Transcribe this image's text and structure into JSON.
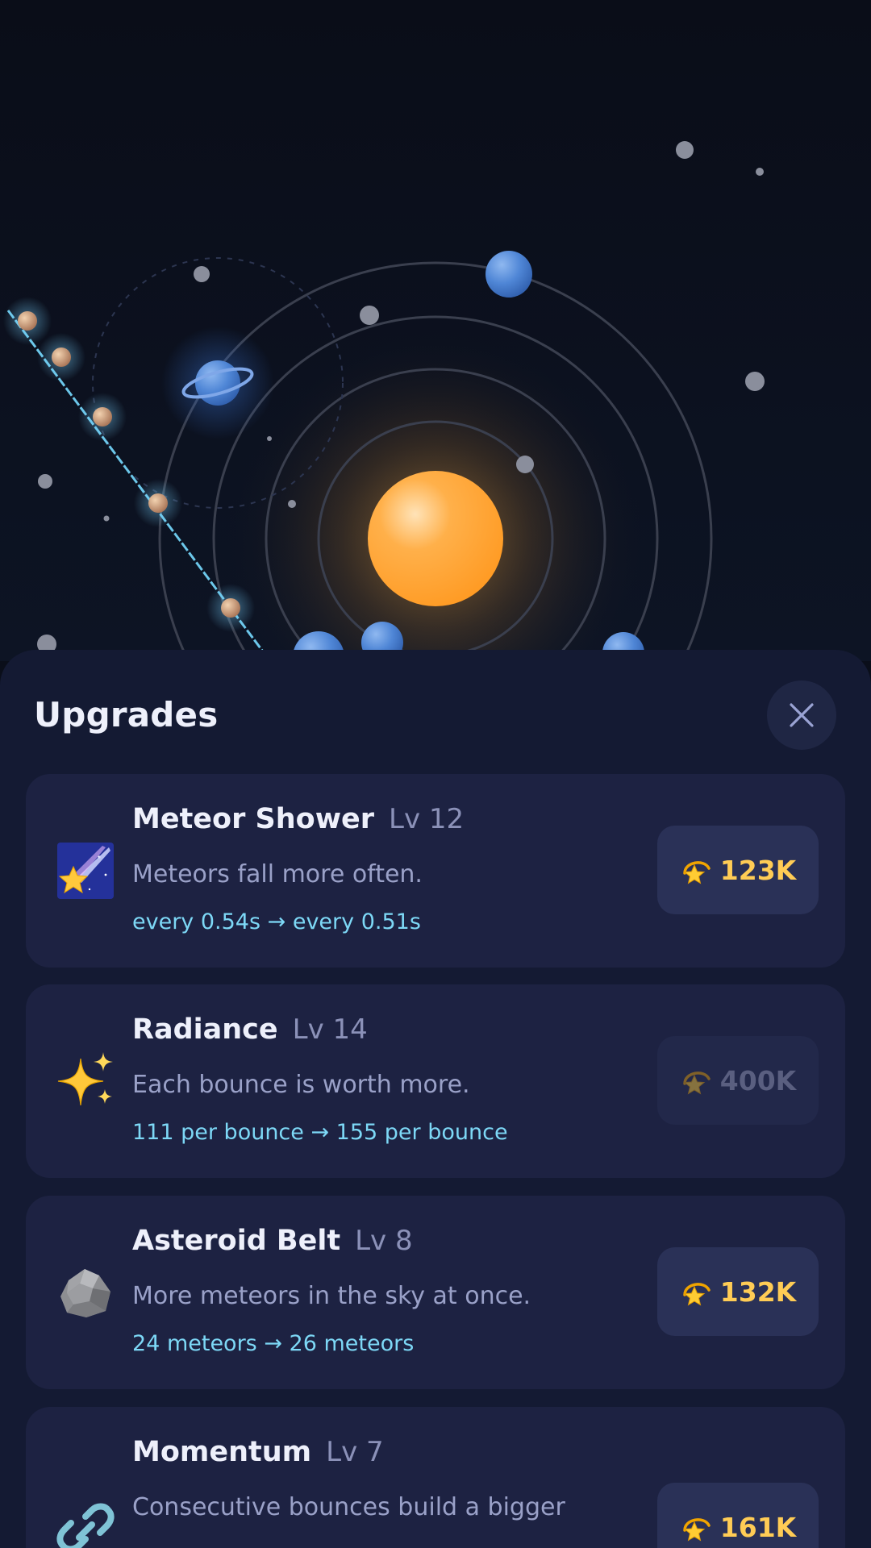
{
  "panel": {
    "title": "Upgrades"
  },
  "upgrades": [
    {
      "name": "Meteor Shower",
      "level": "Lv 12",
      "description": "Meteors fall more often.",
      "effect": "every 0.54s → every 0.51s",
      "price": "123K",
      "icon": "shooting-star-icon",
      "affordable": true
    },
    {
      "name": "Radiance",
      "level": "Lv 14",
      "description": "Each bounce is worth more.",
      "effect": "111 per bounce → 155 per bounce",
      "price": "400K",
      "icon": "sparkles-icon",
      "affordable": false
    },
    {
      "name": "Asteroid Belt",
      "level": "Lv 8",
      "description": "More meteors in the sky at once.",
      "effect": "24 meteors → 26 meteors",
      "price": "132K",
      "icon": "rock-icon",
      "affordable": true
    },
    {
      "name": "Momentum",
      "level": "Lv 7",
      "description": "Consecutive bounces build a bigger",
      "effect": "",
      "price": "161K",
      "icon": "link-icon",
      "affordable": true
    }
  ],
  "colors": {
    "background": "#0a0e1a",
    "sheet": "#141a33",
    "card": "#1d2242",
    "button": "#2a3157",
    "price": "#ffcc55",
    "effect": "#7dd8f6",
    "sun": "#ff9f2a",
    "planet": "#4f86d6"
  }
}
